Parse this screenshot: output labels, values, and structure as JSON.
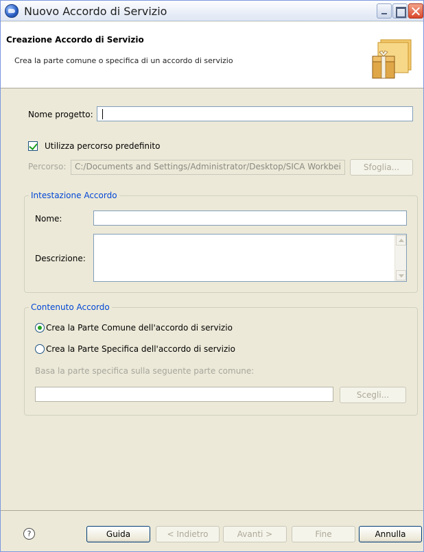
{
  "window": {
    "title": "Nuovo Accordo di Servizio"
  },
  "banner": {
    "title": "Creazione Accordo di Servizio",
    "subtitle": "Crea la parte comune o specifica di un accordo di servizio",
    "icon": "package-wizard-icon"
  },
  "form": {
    "project_name_label": "Nome progetto:",
    "project_name_value": "",
    "use_default_path_label": "Utilizza percorso predefinito",
    "use_default_path_checked": true,
    "path_label": "Percorso:",
    "path_value": "C:/Documents and Settings/Administrator/Desktop/SICA Workbei",
    "browse_button": "Sfoglia..."
  },
  "header_group": {
    "title": "Intestazione Accordo",
    "name_label": "Nome:",
    "name_value": "",
    "description_label": "Descrizione:",
    "description_value": ""
  },
  "content_group": {
    "title": "Contenuto Accordo",
    "option_common": "Crea la Parte Comune dell'accordo di servizio",
    "option_specific": "Crea la Parte Specifica dell'accordo di servizio",
    "selected_option": "common",
    "base_label": "Basa la parte specifica sulla seguente parte comune:",
    "base_value": "",
    "choose_button": "Scegli..."
  },
  "footer": {
    "help_glyph": "?",
    "guide_button": "Guida",
    "back_button": "< Indietro",
    "next_button": "Avanti >",
    "finish_button": "Fine",
    "cancel_button": "Annulla"
  }
}
